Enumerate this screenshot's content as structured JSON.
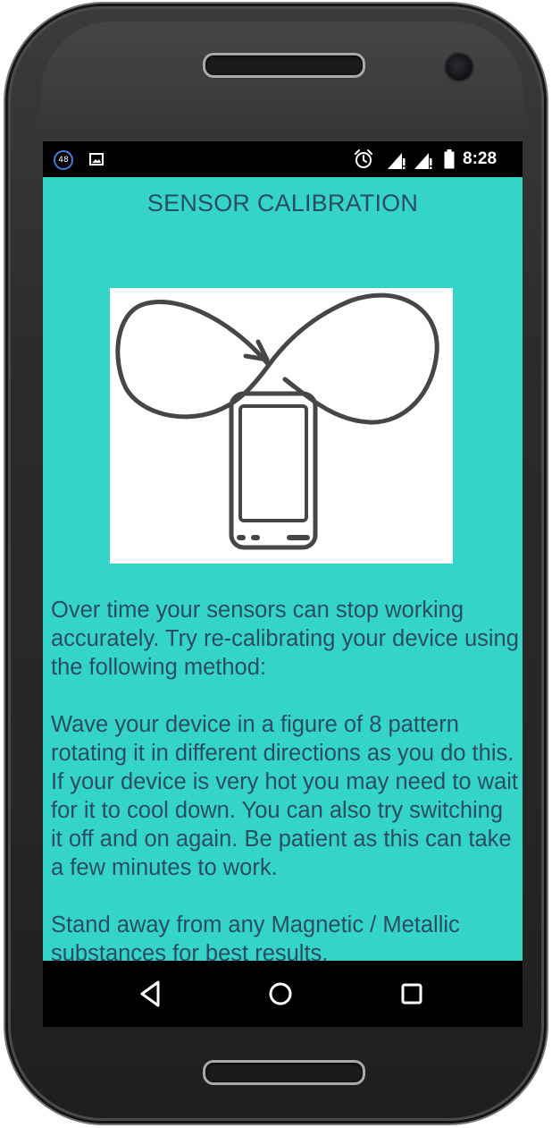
{
  "status_bar": {
    "notification_badge": "48",
    "time": "8:28",
    "icons": [
      "image-notification-icon",
      "alarm-icon",
      "signal-icon",
      "signal-icon",
      "battery-icon"
    ]
  },
  "screen": {
    "title": "SENSOR CALIBRATION",
    "background_color": "#34d5c8",
    "text_color": "#2a4d63",
    "illustration": "figure-eight-phone-calibration-icon",
    "paragraphs": [
      "Over time your sensors can stop working accurately. Try re-calibrating your device using the following method:",
      " Wave your device in a figure of 8 pattern rotating it in different directions as you do this. If your device is very hot you may need to wait for it to cool down. You can also try switching it off and on again. Be patient as this can take a few minutes to work.",
      " Stand away from any Magnetic / Metallic substances for best results."
    ]
  },
  "nav_bar": {
    "buttons": [
      "back-icon",
      "home-icon",
      "recent-apps-icon"
    ]
  }
}
